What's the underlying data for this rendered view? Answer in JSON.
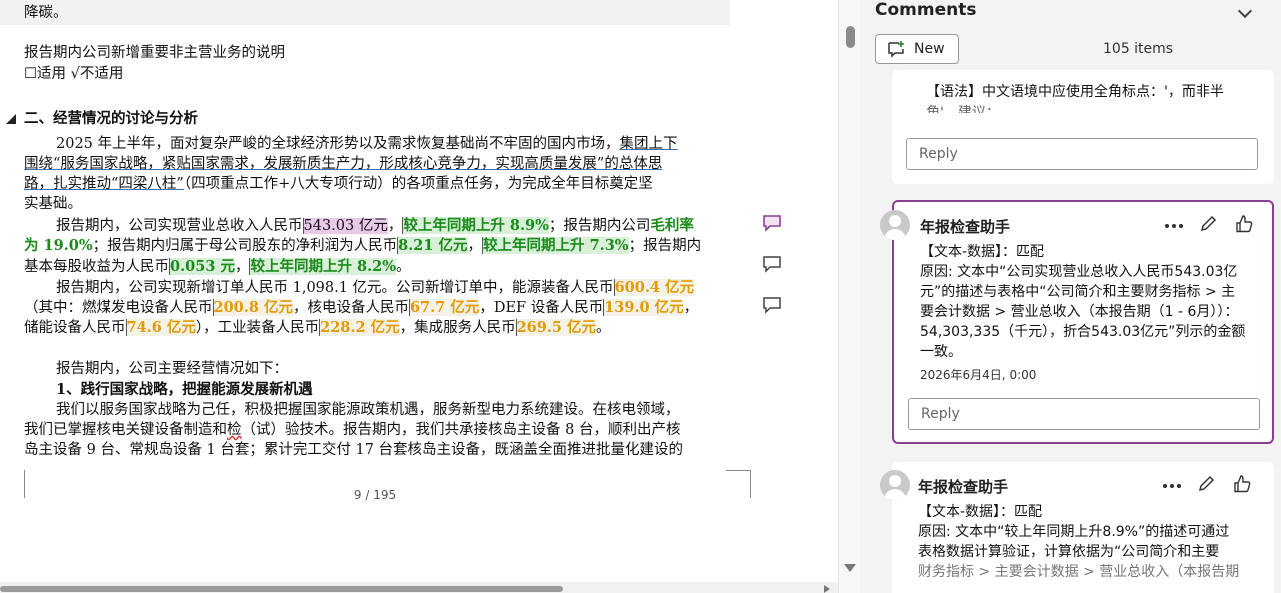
{
  "document": {
    "prev_tail": "降碳。",
    "new_business_title": "报告期内公司新增重要非主营业务的说明",
    "new_business_option": "☐适用 √不适用",
    "section_heading": "二、经营情况的讨论与分析",
    "p1": {
      "a": "2025 年上半年，面对复杂严峻的全球经济形势以及需求恢复基础尚不牢固的国内市场，",
      "b": "集团上下",
      "c": "围绕“服务国家战略，紧贴国家需求，发展新质生产力，形成核心竞争力，",
      "d": "实现高质量发展”的总体思",
      "e": "路，",
      "f": "扎实推动“四梁八柱”",
      "g": "（四项重点工作+八大专项行动）的各项重点任务，为完成全年目标奠定坚",
      "h": "实基础。"
    },
    "p2": {
      "a": "报告期内，公司实现营业总收入人民币",
      "rev": "543.03 亿元",
      "b": "，",
      "rev_growth": "较上年同期上升 8.9%",
      "c": "；报告期内公司",
      "gm1": "毛利率",
      "gm2": "为 19.0%",
      "d": "；报告期内归属于母公司股东的净利润为人民币",
      "np": "8.21 亿元",
      "e": "，",
      "np_growth": "较上年同期上升 7.3%",
      "f": "；报告期内",
      "g": "基本每股收益为人民币",
      "eps": "0.053 元",
      "h": "，",
      "eps_growth": "较上年同期上升 8.2%",
      "i": "。"
    },
    "p3": {
      "a": "报告期内，公司实现新增订单人民币 1,098.1 亿元。公司新增订单中，能源装备人民币",
      "energy": "600.4 亿元",
      "b": "（其中：燃煤发电设备人民币",
      "coal": "200.8 亿元",
      "c": "，核电设备人民币",
      "nuclear": "67.7 亿元",
      "d": "，DEF 设备人民币",
      "def": "139.0 亿元",
      "e": "，",
      "f": "储能设备人民币",
      "storage": "74.6 亿元",
      "g": "），工业装备人民币",
      "industrial": "228.2 亿元",
      "h": "，集成服务人民币",
      "integration": "269.5 亿元",
      "i": "。"
    },
    "p4": "报告期内，公司主要经营情况如下：",
    "sub1": "1、践行国家战略，把握能源发展新机遇",
    "p5": {
      "a": "我们以服务国家战略为己任，积极把握国家能源政策机遇，服务新型电力系统建设。在核电领域，",
      "b": "我们已掌握核电关键设备制造和",
      "c": "检",
      "d": "（试）验技术。报告期内，我们共承接核岛主设备 8 台，顺利出产核",
      "e": "岛主设备 9 台、常规岛设备 1 台套；累计完工交付 17 台套核岛主设备，既涵盖全面推进批量化建设的"
    },
    "page_indicator": "9 / 195"
  },
  "comments_pane": {
    "title": "Comments",
    "new_label": "New",
    "item_count": "105 items",
    "partial_comment": {
      "text": "【语法】中文语境中应使用全角标点：'，而非半",
      "text2": "角'，建议：",
      "reply_placeholder": "Reply"
    },
    "comments": [
      {
        "author": "年报检查助手",
        "lines": [
          "【文本-数据】：匹配",
          "原因: 文本中“公司实现营业总收入人民币543.03亿",
          "元”的描述与表格中“公司简介和主要财务指标 > 主",
          "要会计数据 > 营业总收入（本报告期（1 - 6月））：",
          "54,303,335（千元），折合543.03亿元”列示的金额",
          "一致。"
        ],
        "date": "2026年6月4日, 0:00",
        "reply_placeholder": "Reply"
      },
      {
        "author": "年报检查助手",
        "lines": [
          "【文本-数据】：匹配",
          "原因: 文本中“较上年同期上升8.9%”的描述可通过",
          "表格数据计算验证，计算依据为“公司简介和主要",
          "财务指标 > 主要会计数据 > 营业总收入（本报告期"
        ]
      }
    ]
  },
  "colors": {
    "accent_active_card": "#8a3f97",
    "highlight_green_text": "#1a8a1a",
    "highlight_orange_text": "#e59a00",
    "highlight_purple_bg": "#e8c9e8"
  }
}
